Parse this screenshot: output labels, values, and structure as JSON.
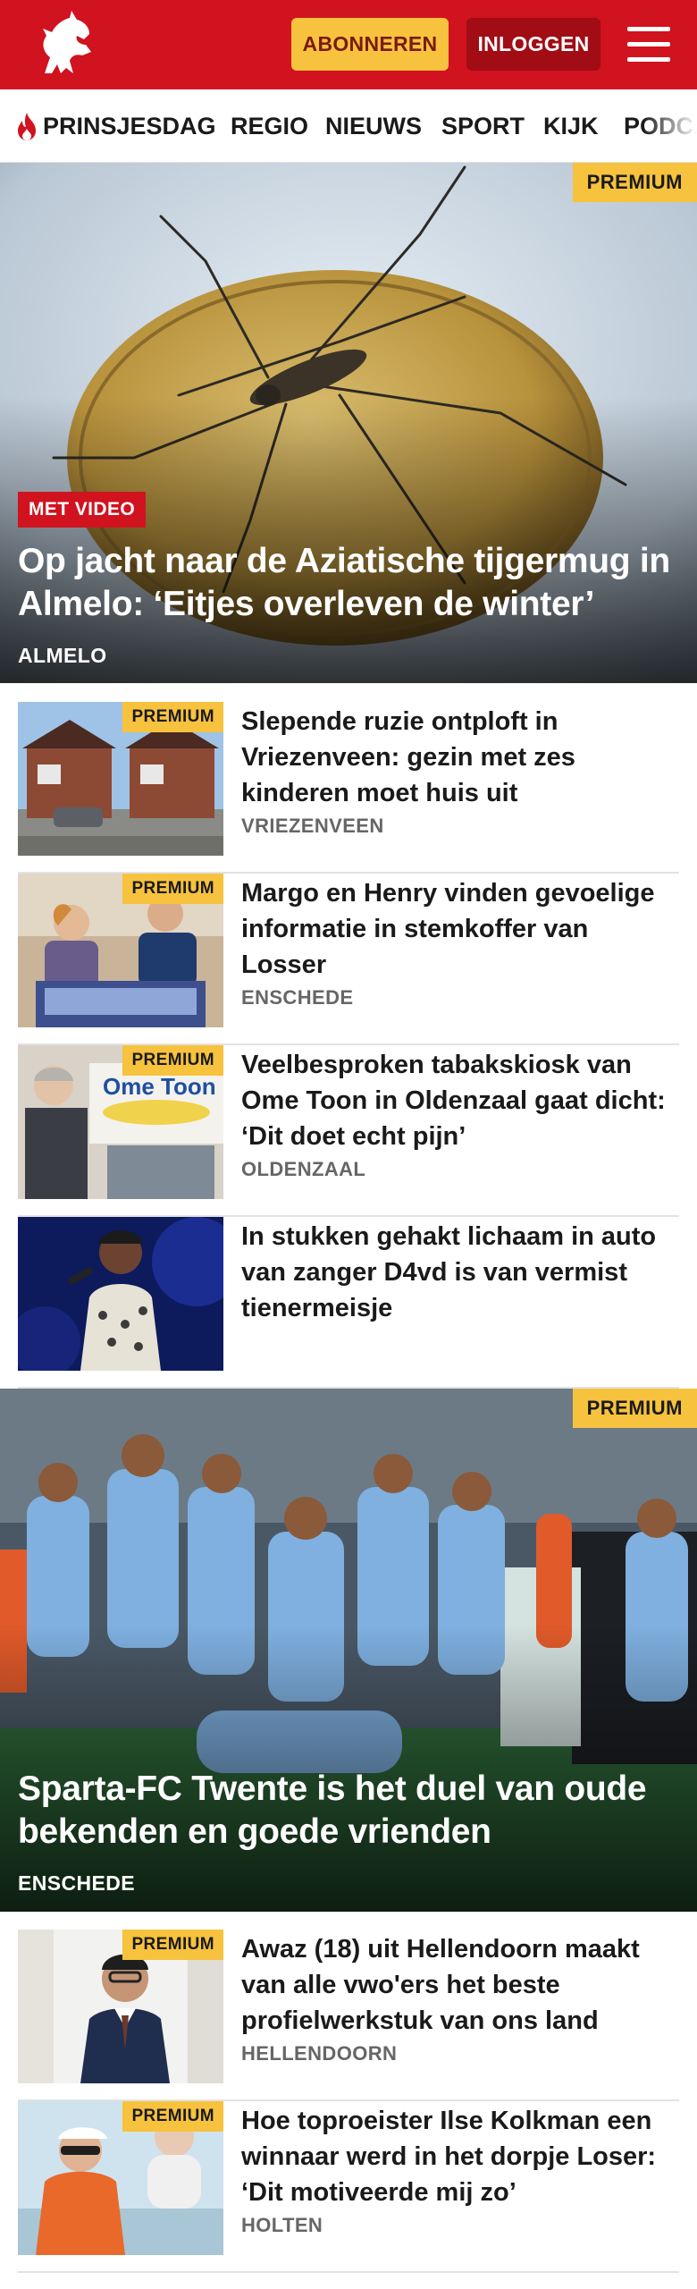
{
  "header": {
    "subscribe_label": "ABONNEREN",
    "login_label": "INLOGGEN",
    "brand_color": "#d1121f",
    "accent_color": "#f7c23d"
  },
  "nav": {
    "items": [
      "PRINSJESDAG",
      "REGIO",
      "NIEUWS",
      "SPORT",
      "KIJK",
      "PODCAST"
    ]
  },
  "hero1": {
    "premium": "PREMIUM",
    "video_badge": "MET VIDEO",
    "title": "Op jacht naar de Aziatische tijgermug in Almelo: ‘Eitjes overleven de winter’",
    "location": "ALMELO"
  },
  "articles1": [
    {
      "premium": "PREMIUM",
      "title": "Slepende ruzie ontploft in Vriezenveen: gezin met zes kinderen moet huis uit",
      "location": "VRIEZENVEEN"
    },
    {
      "premium": "PREMIUM",
      "title": "Margo en Henry vinden gevoelige informatie in stemkoffer van Losser",
      "location": "ENSCHEDE"
    },
    {
      "premium": "PREMIUM",
      "title": "Veelbesproken tabakskiosk van Ome Toon in Oldenzaal gaat dicht: ‘Dit doet echt pijn’",
      "location": "OLDENZAAL",
      "sign_text": "Ome Toon"
    },
    {
      "premium": "",
      "title": "In stukken gehakt lichaam in auto van zanger D4vd is van vermist tienermeisje",
      "location": ""
    }
  ],
  "hero2": {
    "premium": "PREMIUM",
    "title": "Sparta-FC Twente is het duel van oude bekenden en goede vrienden",
    "location": "ENSCHEDE"
  },
  "articles2": [
    {
      "premium": "PREMIUM",
      "title": "Awaz (18) uit Hellendoorn maakt van alle vwo'ers het beste profielwerkstuk van ons land",
      "location": "HELLENDOORN"
    },
    {
      "premium": "PREMIUM",
      "title": "Hoe toproeister Ilse Kolkman een winnaar werd in het dorpje Loser: ‘Dit motiveerde mij zo’",
      "location": "HOLTEN"
    }
  ]
}
